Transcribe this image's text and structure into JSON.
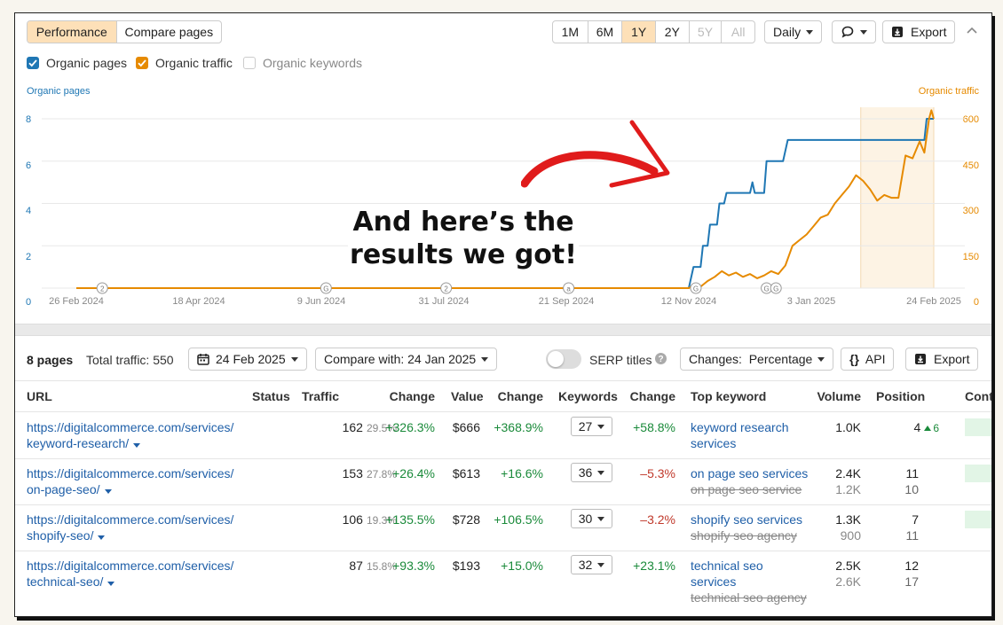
{
  "tabs": {
    "performance": "Performance",
    "compare": "Compare pages"
  },
  "ranges": [
    "1M",
    "6M",
    "1Y",
    "2Y",
    "5Y",
    "All"
  ],
  "toolbar": {
    "interval": "Daily",
    "export": "Export"
  },
  "legend": {
    "organic_pages": "Organic pages",
    "organic_traffic": "Organic traffic",
    "organic_keywords": "Organic keywords"
  },
  "colors": {
    "pages": "#1f77b4",
    "traffic": "#e68a00",
    "active_tab": "#fde0b8"
  },
  "overlay_text": {
    "line1": "And here’s the",
    "line2": "results we got!"
  },
  "chart_data": {
    "type": "line",
    "left_axis_title": "Organic pages",
    "right_axis_title": "Organic traffic",
    "left_ticks": [
      "0",
      "2",
      "4",
      "6",
      "8"
    ],
    "right_ticks": [
      "0",
      "150",
      "300",
      "450",
      "600"
    ],
    "x_ticks": [
      "26 Feb 2024",
      "18 Apr 2024",
      "9 Jun 2024",
      "31 Jul 2024",
      "21 Sep 2024",
      "12 Nov 2024",
      "3 Jan 2025",
      "24 Feb 2025"
    ],
    "annotation_markers": [
      "2",
      "G",
      "2",
      "a",
      "G",
      "G",
      "G"
    ],
    "ylim_left": [
      0,
      8
    ],
    "ylim_right": [
      0,
      600
    ],
    "series": [
      {
        "name": "Organic pages",
        "points": [
          [
            "2024-02-26",
            0
          ],
          [
            "2024-11-12",
            0
          ],
          [
            "2024-11-14",
            1
          ],
          [
            "2024-11-17",
            1
          ],
          [
            "2024-11-18",
            2
          ],
          [
            "2024-11-20",
            2
          ],
          [
            "2024-11-21",
            3
          ],
          [
            "2024-11-24",
            3
          ],
          [
            "2024-11-25",
            4
          ],
          [
            "2024-11-27",
            4
          ],
          [
            "2024-11-28",
            4.5
          ],
          [
            "2024-12-08",
            4.5
          ],
          [
            "2024-12-09",
            5
          ],
          [
            "2024-12-10",
            4.5
          ],
          [
            "2024-12-14",
            4.5
          ],
          [
            "2024-12-15",
            6
          ],
          [
            "2024-12-22",
            6
          ],
          [
            "2024-12-24",
            7
          ],
          [
            "2025-02-20",
            7
          ],
          [
            "2025-02-21",
            8
          ],
          [
            "2025-02-24",
            8
          ]
        ]
      },
      {
        "name": "Organic traffic",
        "points": [
          [
            "2024-02-26",
            0
          ],
          [
            "2024-11-12",
            0
          ],
          [
            "2024-11-15",
            15
          ],
          [
            "2024-11-17",
            5
          ],
          [
            "2024-11-20",
            25
          ],
          [
            "2024-11-23",
            40
          ],
          [
            "2024-11-26",
            60
          ],
          [
            "2024-11-29",
            45
          ],
          [
            "2024-12-02",
            55
          ],
          [
            "2024-12-05",
            40
          ],
          [
            "2024-12-08",
            50
          ],
          [
            "2024-12-11",
            35
          ],
          [
            "2024-12-14",
            45
          ],
          [
            "2024-12-17",
            60
          ],
          [
            "2024-12-20",
            50
          ],
          [
            "2024-12-23",
            80
          ],
          [
            "2024-12-26",
            150
          ],
          [
            "2024-12-29",
            170
          ],
          [
            "2025-01-01",
            190
          ],
          [
            "2025-01-04",
            220
          ],
          [
            "2025-01-07",
            250
          ],
          [
            "2025-01-10",
            260
          ],
          [
            "2025-01-13",
            300
          ],
          [
            "2025-01-16",
            330
          ],
          [
            "2025-01-19",
            360
          ],
          [
            "2025-01-22",
            400
          ],
          [
            "2025-01-25",
            380
          ],
          [
            "2025-01-28",
            350
          ],
          [
            "2025-01-31",
            310
          ],
          [
            "2025-02-03",
            330
          ],
          [
            "2025-02-06",
            320
          ],
          [
            "2025-02-09",
            320
          ],
          [
            "2025-02-12",
            470
          ],
          [
            "2025-02-15",
            460
          ],
          [
            "2025-02-18",
            520
          ],
          [
            "2025-02-20",
            480
          ],
          [
            "2025-02-22",
            600
          ],
          [
            "2025-02-23",
            630
          ],
          [
            "2025-02-24",
            600
          ]
        ]
      }
    ]
  },
  "summary": {
    "pages": "8 pages",
    "total_traffic": "Total traffic: 550",
    "date": "24 Feb 2025",
    "compare": "Compare with: 24 Jan 2025",
    "serp_titles": "SERP titles",
    "changes": "Changes:  Percentage",
    "api": "API",
    "export": "Export"
  },
  "table": {
    "headers": [
      "URL",
      "Status",
      "Traffic",
      "Change",
      "Value",
      "Change",
      "Keywords",
      "Change",
      "Top keyword",
      "Volume",
      "Position",
      "Cont"
    ],
    "rows": [
      {
        "url1": "https://digitalcommerce.com/services/",
        "url2": "keyword-research/",
        "traffic": "162",
        "traffic_pct": "29.5%",
        "change": "+326.3%",
        "value": "$666",
        "value_change": "+368.9%",
        "keywords": "27",
        "kw_change": "+58.8%",
        "top_kw": "keyword research services",
        "top_kw_sub": "",
        "volume": "1.0K",
        "volume_sub": "",
        "position": "4",
        "position_up": "6",
        "position_sub": ""
      },
      {
        "url1": "https://digitalcommerce.com/services/",
        "url2": "on-page-seo/",
        "traffic": "153",
        "traffic_pct": "27.8%",
        "change": "+26.4%",
        "value": "$613",
        "value_change": "+16.6%",
        "keywords": "36",
        "kw_change": "–5.3%",
        "top_kw": "on page seo services",
        "top_kw_sub": "on page seo service",
        "volume": "2.4K",
        "volume_sub": "1.2K",
        "position": "11",
        "position_up": "",
        "position_sub": "10"
      },
      {
        "url1": "https://digitalcommerce.com/services/",
        "url2": "shopify-seo/",
        "traffic": "106",
        "traffic_pct": "19.3%",
        "change": "+135.5%",
        "value": "$728",
        "value_change": "+106.5%",
        "keywords": "30",
        "kw_change": "–3.2%",
        "top_kw": "shopify seo services",
        "top_kw_sub": "shopify seo agency",
        "volume": "1.3K",
        "volume_sub": "900",
        "position": "7",
        "position_up": "",
        "position_sub": "11"
      },
      {
        "url1": "https://digitalcommerce.com/services/",
        "url2": "technical-seo/",
        "traffic": "87",
        "traffic_pct": "15.8%",
        "change": "+93.3%",
        "value": "$193",
        "value_change": "+15.0%",
        "keywords": "32",
        "kw_change": "+23.1%",
        "top_kw": "technical seo services",
        "top_kw_sub": "technical seo agency",
        "volume": "2.5K",
        "volume_sub": "2.6K",
        "position": "12",
        "position_up": "",
        "position_sub": "17"
      }
    ]
  }
}
